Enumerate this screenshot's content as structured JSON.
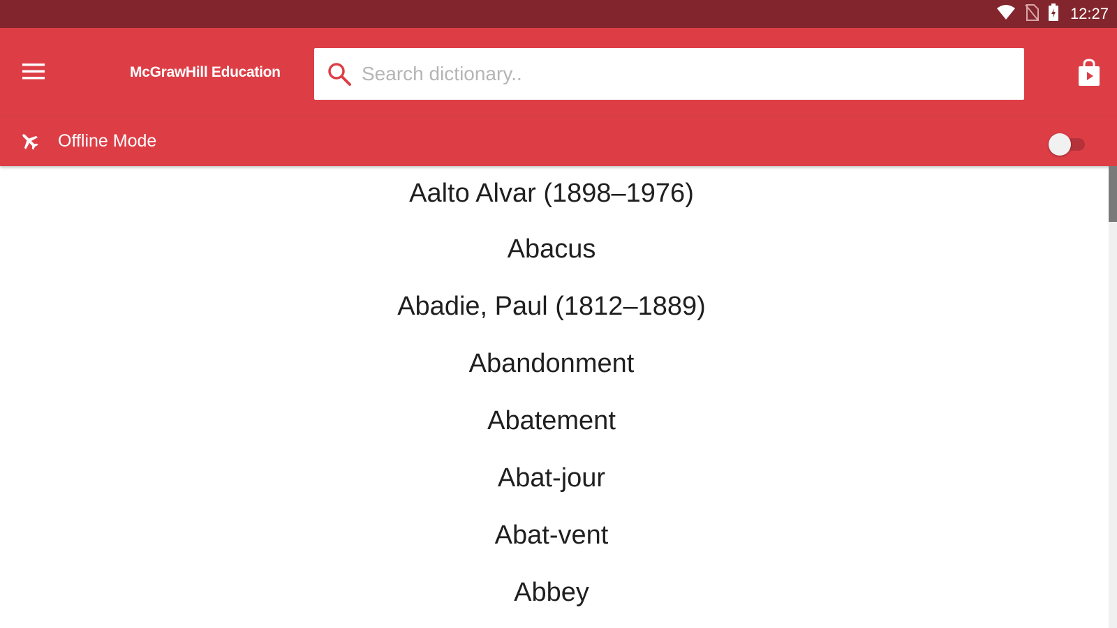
{
  "status_bar": {
    "time": "12:27",
    "icons": [
      "wifi-icon",
      "no-sim-icon",
      "battery-icon"
    ]
  },
  "app_bar": {
    "brand": "McGrawHill Education",
    "menu_icon": "hamburger-menu-icon",
    "search": {
      "placeholder": "Search dictionary..",
      "value": "",
      "icon": "search-icon"
    },
    "store_icon": "shopping-bag-play-icon"
  },
  "offline_bar": {
    "icon": "airplane-icon",
    "label": "Offline Mode",
    "toggle_on": false
  },
  "entries": [
    "Aalto Alvar (1898–1976)",
    "Abacus",
    "Abadie, Paul (1812–1889)",
    "Abandonment",
    "Abatement",
    "Abat-jour",
    "Abat-vent",
    "Abbey"
  ],
  "colors": {
    "status_bar": "#82252c",
    "primary": "#dd3e46",
    "search_icon": "#dd3e46"
  }
}
